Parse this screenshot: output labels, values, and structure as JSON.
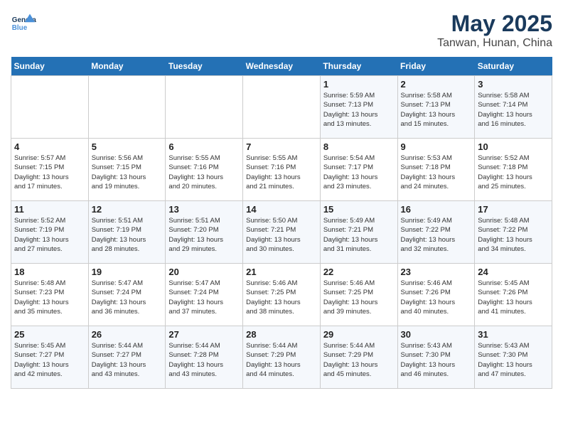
{
  "app": {
    "name": "GeneralBlue",
    "title": "May 2025",
    "subtitle": "Tanwan, Hunan, China"
  },
  "days_of_week": [
    "Sunday",
    "Monday",
    "Tuesday",
    "Wednesday",
    "Thursday",
    "Friday",
    "Saturday"
  ],
  "weeks": [
    [
      {
        "day": "",
        "info": ""
      },
      {
        "day": "",
        "info": ""
      },
      {
        "day": "",
        "info": ""
      },
      {
        "day": "",
        "info": ""
      },
      {
        "day": "1",
        "info": "Sunrise: 5:59 AM\nSunset: 7:13 PM\nDaylight: 13 hours\nand 13 minutes."
      },
      {
        "day": "2",
        "info": "Sunrise: 5:58 AM\nSunset: 7:13 PM\nDaylight: 13 hours\nand 15 minutes."
      },
      {
        "day": "3",
        "info": "Sunrise: 5:58 AM\nSunset: 7:14 PM\nDaylight: 13 hours\nand 16 minutes."
      }
    ],
    [
      {
        "day": "4",
        "info": "Sunrise: 5:57 AM\nSunset: 7:15 PM\nDaylight: 13 hours\nand 17 minutes."
      },
      {
        "day": "5",
        "info": "Sunrise: 5:56 AM\nSunset: 7:15 PM\nDaylight: 13 hours\nand 19 minutes."
      },
      {
        "day": "6",
        "info": "Sunrise: 5:55 AM\nSunset: 7:16 PM\nDaylight: 13 hours\nand 20 minutes."
      },
      {
        "day": "7",
        "info": "Sunrise: 5:55 AM\nSunset: 7:16 PM\nDaylight: 13 hours\nand 21 minutes."
      },
      {
        "day": "8",
        "info": "Sunrise: 5:54 AM\nSunset: 7:17 PM\nDaylight: 13 hours\nand 23 minutes."
      },
      {
        "day": "9",
        "info": "Sunrise: 5:53 AM\nSunset: 7:18 PM\nDaylight: 13 hours\nand 24 minutes."
      },
      {
        "day": "10",
        "info": "Sunrise: 5:52 AM\nSunset: 7:18 PM\nDaylight: 13 hours\nand 25 minutes."
      }
    ],
    [
      {
        "day": "11",
        "info": "Sunrise: 5:52 AM\nSunset: 7:19 PM\nDaylight: 13 hours\nand 27 minutes."
      },
      {
        "day": "12",
        "info": "Sunrise: 5:51 AM\nSunset: 7:19 PM\nDaylight: 13 hours\nand 28 minutes."
      },
      {
        "day": "13",
        "info": "Sunrise: 5:51 AM\nSunset: 7:20 PM\nDaylight: 13 hours\nand 29 minutes."
      },
      {
        "day": "14",
        "info": "Sunrise: 5:50 AM\nSunset: 7:21 PM\nDaylight: 13 hours\nand 30 minutes."
      },
      {
        "day": "15",
        "info": "Sunrise: 5:49 AM\nSunset: 7:21 PM\nDaylight: 13 hours\nand 31 minutes."
      },
      {
        "day": "16",
        "info": "Sunrise: 5:49 AM\nSunset: 7:22 PM\nDaylight: 13 hours\nand 32 minutes."
      },
      {
        "day": "17",
        "info": "Sunrise: 5:48 AM\nSunset: 7:22 PM\nDaylight: 13 hours\nand 34 minutes."
      }
    ],
    [
      {
        "day": "18",
        "info": "Sunrise: 5:48 AM\nSunset: 7:23 PM\nDaylight: 13 hours\nand 35 minutes."
      },
      {
        "day": "19",
        "info": "Sunrise: 5:47 AM\nSunset: 7:24 PM\nDaylight: 13 hours\nand 36 minutes."
      },
      {
        "day": "20",
        "info": "Sunrise: 5:47 AM\nSunset: 7:24 PM\nDaylight: 13 hours\nand 37 minutes."
      },
      {
        "day": "21",
        "info": "Sunrise: 5:46 AM\nSunset: 7:25 PM\nDaylight: 13 hours\nand 38 minutes."
      },
      {
        "day": "22",
        "info": "Sunrise: 5:46 AM\nSunset: 7:25 PM\nDaylight: 13 hours\nand 39 minutes."
      },
      {
        "day": "23",
        "info": "Sunrise: 5:46 AM\nSunset: 7:26 PM\nDaylight: 13 hours\nand 40 minutes."
      },
      {
        "day": "24",
        "info": "Sunrise: 5:45 AM\nSunset: 7:26 PM\nDaylight: 13 hours\nand 41 minutes."
      }
    ],
    [
      {
        "day": "25",
        "info": "Sunrise: 5:45 AM\nSunset: 7:27 PM\nDaylight: 13 hours\nand 42 minutes."
      },
      {
        "day": "26",
        "info": "Sunrise: 5:44 AM\nSunset: 7:27 PM\nDaylight: 13 hours\nand 43 minutes."
      },
      {
        "day": "27",
        "info": "Sunrise: 5:44 AM\nSunset: 7:28 PM\nDaylight: 13 hours\nand 43 minutes."
      },
      {
        "day": "28",
        "info": "Sunrise: 5:44 AM\nSunset: 7:29 PM\nDaylight: 13 hours\nand 44 minutes."
      },
      {
        "day": "29",
        "info": "Sunrise: 5:44 AM\nSunset: 7:29 PM\nDaylight: 13 hours\nand 45 minutes."
      },
      {
        "day": "30",
        "info": "Sunrise: 5:43 AM\nSunset: 7:30 PM\nDaylight: 13 hours\nand 46 minutes."
      },
      {
        "day": "31",
        "info": "Sunrise: 5:43 AM\nSunset: 7:30 PM\nDaylight: 13 hours\nand 47 minutes."
      }
    ]
  ]
}
